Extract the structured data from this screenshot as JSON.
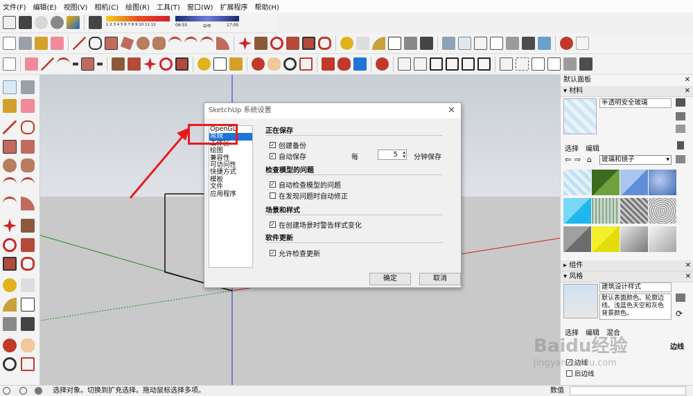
{
  "menu": [
    "文件(F)",
    "编辑(E)",
    "视图(V)",
    "相机(C)",
    "绘图(R)",
    "工具(T)",
    "窗口(W)",
    "扩展程序",
    "帮助(H)"
  ],
  "shadow": {
    "months": "1 2 3 4 5 6 7 8 9 10 11 12",
    "time_start": "06:55",
    "time_mid": "中午",
    "time_end": "17:00"
  },
  "dialog": {
    "title": "SketchUp 系统设置",
    "close": "✕",
    "categories": [
      "OpenGL",
      "常规",
      "工作区",
      "绘图",
      "兼容性",
      "可访问性",
      "快捷方式",
      "模板",
      "文件",
      "应用程序"
    ],
    "selected_index": 1,
    "sections": {
      "saving": "正在保存",
      "check_model": "检查模型的问题",
      "scenes": "场景和样式",
      "updates": "软件更新"
    },
    "options": {
      "backup": "创建备份",
      "autosave": "自动保存",
      "every": "每",
      "minutes_value": "5",
      "minutes_label": "分钟保存",
      "auto_check": "自动检查模型的问题",
      "auto_fix": "在发现问题时自动修正",
      "warn_style": "在创建场景时警告样式变化",
      "allow_update": "允许检查更新"
    },
    "checks": {
      "backup": true,
      "autosave": true,
      "auto_check": true,
      "auto_fix": false,
      "warn_style": true,
      "allow_update": true
    },
    "ok": "确定",
    "cancel": "取消"
  },
  "tray": {
    "title": "默认面板",
    "materials": {
      "header": "材料",
      "name": "半透明安全玻璃",
      "tab_select": "选择",
      "tab_edit": "编辑",
      "library": "玻璃和镜子"
    },
    "components": "组件",
    "styles": {
      "header": "风格",
      "name": "建筑设计样式",
      "description": "默认表面颜色。轮廓边线。浅蓝色天空和灰色背景颜色。",
      "tab_select": "选择",
      "tab_edit": "编辑",
      "tab_mix": "混合",
      "edges": "边线",
      "edge_opt1": "边线",
      "edge_opt2": "后边线"
    }
  },
  "status": {
    "text": "选择对象。切换到扩充选择。拖动鼠标选择多项。",
    "measure_label": "数值"
  },
  "watermark": {
    "brand": "Baidu经验",
    "url": "jingyan.baidu.com"
  },
  "colors": {
    "accent": "#1e74d8",
    "highlight_box": "#e8191b",
    "arrow": "#e8191b"
  }
}
